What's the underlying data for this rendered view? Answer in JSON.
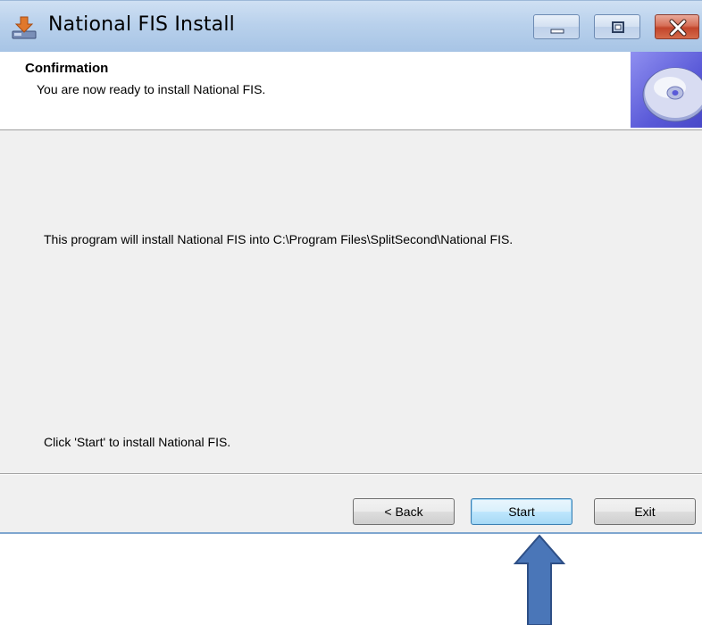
{
  "window": {
    "title": "National FIS Install"
  },
  "header": {
    "title": "Confirmation",
    "subtitle": "You are now ready to install National FIS."
  },
  "body": {
    "install_path_text": "This program will install National FIS into C:\\Program Files\\SplitSecond\\National FIS.",
    "instruction_text": "Click 'Start' to install National FIS."
  },
  "buttons": {
    "back_label": "< Back",
    "start_label": "Start",
    "exit_label": "Exit"
  },
  "icons": {
    "app": "installer-icon",
    "minimize": "minimize-icon",
    "maximize": "maximize-icon",
    "close": "close-icon",
    "header_image": "cd-disc-icon",
    "annotation": "up-arrow-icon"
  },
  "colors": {
    "titlebar": "#b9d1ec",
    "close_button": "#c2452b",
    "default_button_border": "#3c7fb1",
    "annotation_arrow": "#4a76b8"
  }
}
